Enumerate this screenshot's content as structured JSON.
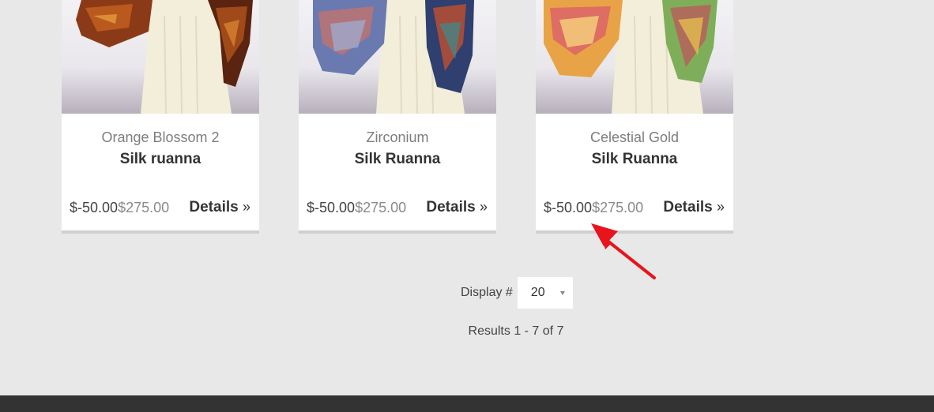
{
  "products": [
    {
      "color_name": "Orange Blossom 2",
      "type_name": "Silk ruanna",
      "discount_price": "$-50.00",
      "regular_price": "$275.00",
      "details_label": "Details",
      "chevron": "»"
    },
    {
      "color_name": "Zirconium",
      "type_name": "Silk Ruanna",
      "discount_price": "$-50.00",
      "regular_price": "$275.00",
      "details_label": "Details",
      "chevron": "»"
    },
    {
      "color_name": "Celestial Gold",
      "type_name": "Silk Ruanna",
      "discount_price": "$-50.00",
      "regular_price": "$275.00",
      "details_label": "Details",
      "chevron": "»"
    }
  ],
  "pagination": {
    "display_label": "Display #",
    "display_value": "20",
    "results_text": "Results 1 - 7 of 7"
  },
  "icons": {
    "dropdown": "caret-down-icon",
    "annotation": "red-arrow-icon"
  },
  "colors": {
    "page_background": "#e9e8e8",
    "footer": "#333333",
    "annotation_arrow": "#e8141b"
  }
}
